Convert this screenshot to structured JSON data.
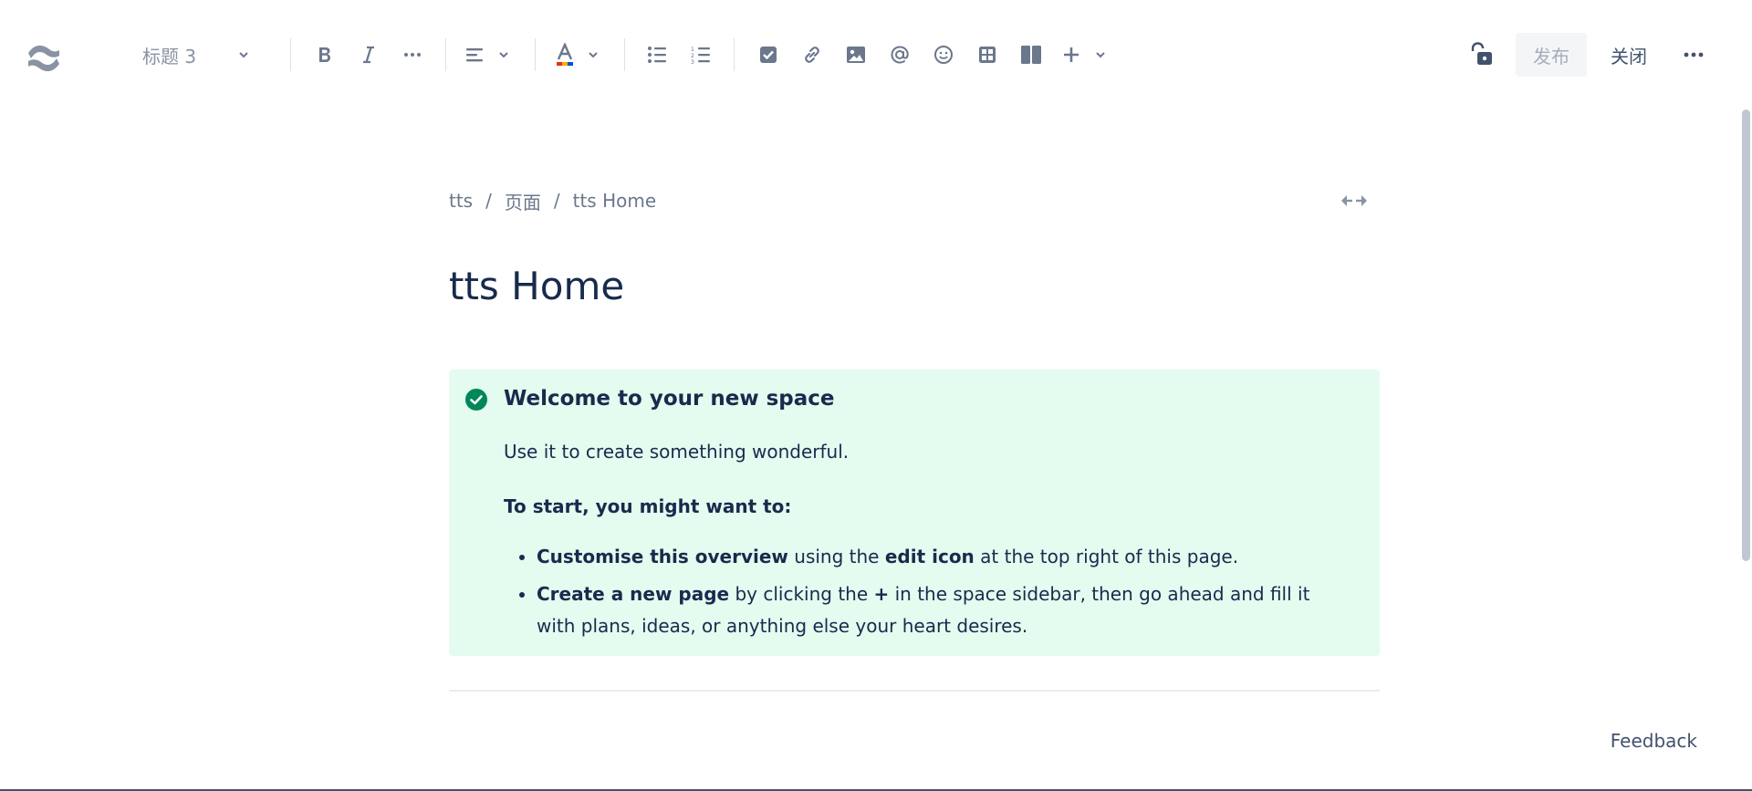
{
  "toolbar": {
    "text_style": "标题 3",
    "publish_label": "发布",
    "close_label": "关闭"
  },
  "breadcrumb": [
    "tts",
    "页面",
    "tts Home"
  ],
  "page": {
    "title": "tts Home"
  },
  "panel": {
    "heading": "Welcome to your new space",
    "intro": "Use it to create something wonderful.",
    "subheading": "To start, you might want to:",
    "items": [
      {
        "b1": "Customise this overview",
        "t1": " using the ",
        "b2": "edit icon",
        "t2": " at the top right of this page."
      },
      {
        "b1": "Create a new page",
        "t1": " by clicking the ",
        "b2": "+",
        "t2": " in the space sidebar, then go ahead and fill it with plans, ideas, or anything else your heart desires."
      }
    ]
  },
  "feedback_label": "Feedback",
  "colors": {
    "panel_bg": "#e3fcef",
    "success_icon": "#00875a",
    "text": "#172b4d",
    "muted": "#6b778c"
  }
}
